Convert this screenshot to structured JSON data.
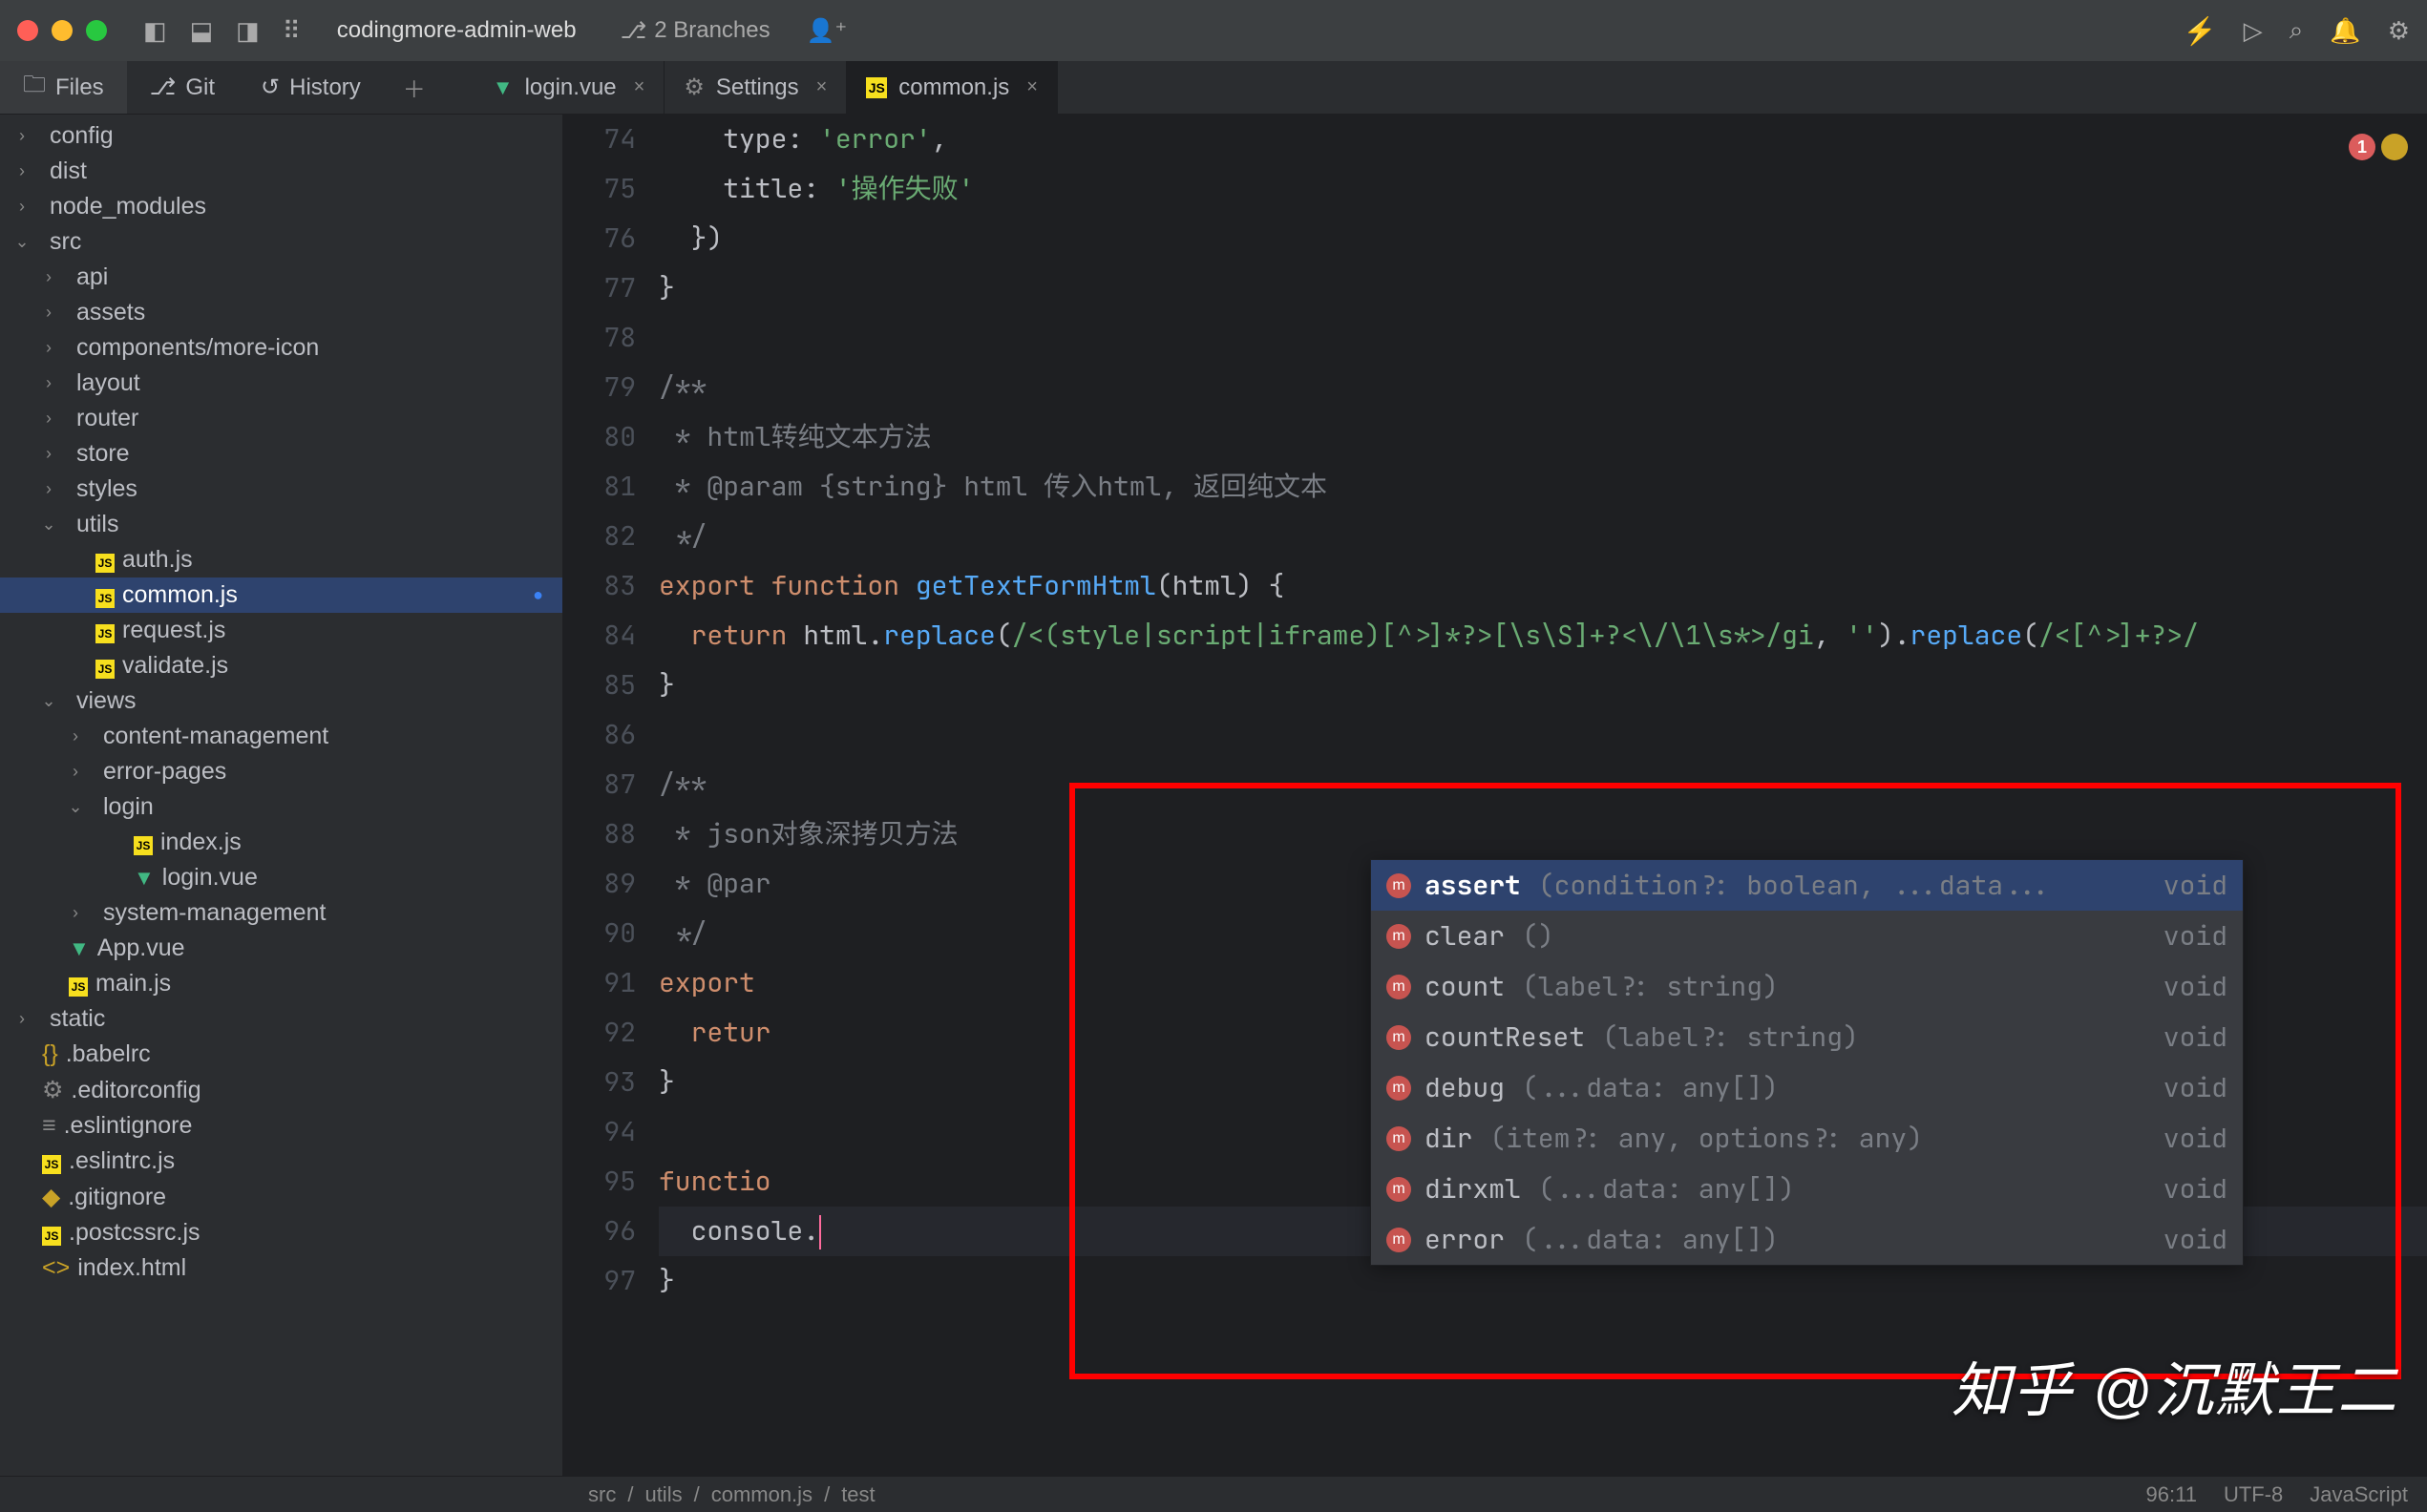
{
  "titlebar": {
    "project": "codingmore-admin-web",
    "branches": "2 Branches"
  },
  "nav_tabs": {
    "files": "Files",
    "git": "Git",
    "history": "History"
  },
  "editor_tabs": [
    {
      "label": "login.vue",
      "icon": "vue",
      "active": false
    },
    {
      "label": "Settings",
      "icon": "gear",
      "active": false
    },
    {
      "label": "common.js",
      "icon": "js",
      "active": true
    }
  ],
  "file_tree": [
    {
      "label": "config",
      "indent": 0,
      "chev": "›",
      "icon": ""
    },
    {
      "label": "dist",
      "indent": 0,
      "chev": "›",
      "icon": ""
    },
    {
      "label": "node_modules",
      "indent": 0,
      "chev": "›",
      "icon": ""
    },
    {
      "label": "src",
      "indent": 0,
      "chev": "⌄",
      "icon": ""
    },
    {
      "label": "api",
      "indent": 1,
      "chev": "›",
      "icon": ""
    },
    {
      "label": "assets",
      "indent": 1,
      "chev": "›",
      "icon": ""
    },
    {
      "label": "components/more-icon",
      "indent": 1,
      "chev": "›",
      "icon": ""
    },
    {
      "label": "layout",
      "indent": 1,
      "chev": "›",
      "icon": ""
    },
    {
      "label": "router",
      "indent": 1,
      "chev": "›",
      "icon": ""
    },
    {
      "label": "store",
      "indent": 1,
      "chev": "›",
      "icon": ""
    },
    {
      "label": "styles",
      "indent": 1,
      "chev": "›",
      "icon": ""
    },
    {
      "label": "utils",
      "indent": 1,
      "chev": "⌄",
      "icon": ""
    },
    {
      "label": "auth.js",
      "indent": 2,
      "chev": "",
      "icon": "js"
    },
    {
      "label": "common.js",
      "indent": 2,
      "chev": "",
      "icon": "js",
      "selected": true,
      "modified": true
    },
    {
      "label": "request.js",
      "indent": 2,
      "chev": "",
      "icon": "js"
    },
    {
      "label": "validate.js",
      "indent": 2,
      "chev": "",
      "icon": "js"
    },
    {
      "label": "views",
      "indent": 1,
      "chev": "⌄",
      "icon": ""
    },
    {
      "label": "content-management",
      "indent": 2,
      "chev": "›",
      "icon": ""
    },
    {
      "label": "error-pages",
      "indent": 2,
      "chev": "›",
      "icon": ""
    },
    {
      "label": "login",
      "indent": 2,
      "chev": "⌄",
      "icon": ""
    },
    {
      "label": "index.js",
      "indent": 2,
      "chev": "",
      "icon": "js",
      "extra_indent": true
    },
    {
      "label": "login.vue",
      "indent": 2,
      "chev": "",
      "icon": "vue",
      "extra_indent": true
    },
    {
      "label": "system-management",
      "indent": 2,
      "chev": "›",
      "icon": ""
    },
    {
      "label": "App.vue",
      "indent": 1,
      "chev": "",
      "icon": "vue"
    },
    {
      "label": "main.js",
      "indent": 1,
      "chev": "",
      "icon": "js"
    },
    {
      "label": "static",
      "indent": 0,
      "chev": "›",
      "icon": ""
    },
    {
      "label": ".babelrc",
      "indent": 0,
      "chev": "",
      "icon": "brace"
    },
    {
      "label": ".editorconfig",
      "indent": 0,
      "chev": "",
      "icon": "gear"
    },
    {
      "label": ".eslintignore",
      "indent": 0,
      "chev": "",
      "icon": "lines"
    },
    {
      "label": ".eslintrc.js",
      "indent": 0,
      "chev": "",
      "icon": "js"
    },
    {
      "label": ".gitignore",
      "indent": 0,
      "chev": "",
      "icon": "git"
    },
    {
      "label": ".postcssrc.js",
      "indent": 0,
      "chev": "",
      "icon": "js"
    },
    {
      "label": "index.html",
      "indent": 0,
      "chev": "",
      "icon": "html"
    }
  ],
  "code_lines": {
    "74": "type: 'error',",
    "75": "title: '操作失败'",
    "88_comment": "json对象深拷贝方法",
    "80_comment": "html转纯文本方法",
    "81_comment": "@param {string} html 传入html, 返回纯文本",
    "fn_get_text": "getTextFormHtml",
    "fn_return": "return html.replace(/<(style|script|iframe)[^>]*?>[\\s\\S]+?<\\/\\1\\s*>/gi, '').replace(/<[^>]+?>/"
  },
  "autocomplete": [
    {
      "name": "assert",
      "sig": "(condition?: boolean, ...data...",
      "ret": "void",
      "selected": true
    },
    {
      "name": "clear",
      "sig": "()",
      "ret": "void"
    },
    {
      "name": "count",
      "sig": "(label?: string)",
      "ret": "void"
    },
    {
      "name": "countReset",
      "sig": "(label?: string)",
      "ret": "void"
    },
    {
      "name": "debug",
      "sig": "(...data: any[])",
      "ret": "void"
    },
    {
      "name": "dir",
      "sig": "(item?: any, options?: any)",
      "ret": "void"
    },
    {
      "name": "dirxml",
      "sig": "(...data: any[])",
      "ret": "void"
    },
    {
      "name": "error",
      "sig": "(...data: any[])",
      "ret": "void"
    }
  ],
  "breadcrumb": [
    "src",
    "utils",
    "common.js",
    "test"
  ],
  "statusbar": {
    "pos": "96:11",
    "encoding": "UTF-8",
    "lang": "JavaScript"
  },
  "error_badge": "1",
  "watermark": "知乎 @沉默王二"
}
